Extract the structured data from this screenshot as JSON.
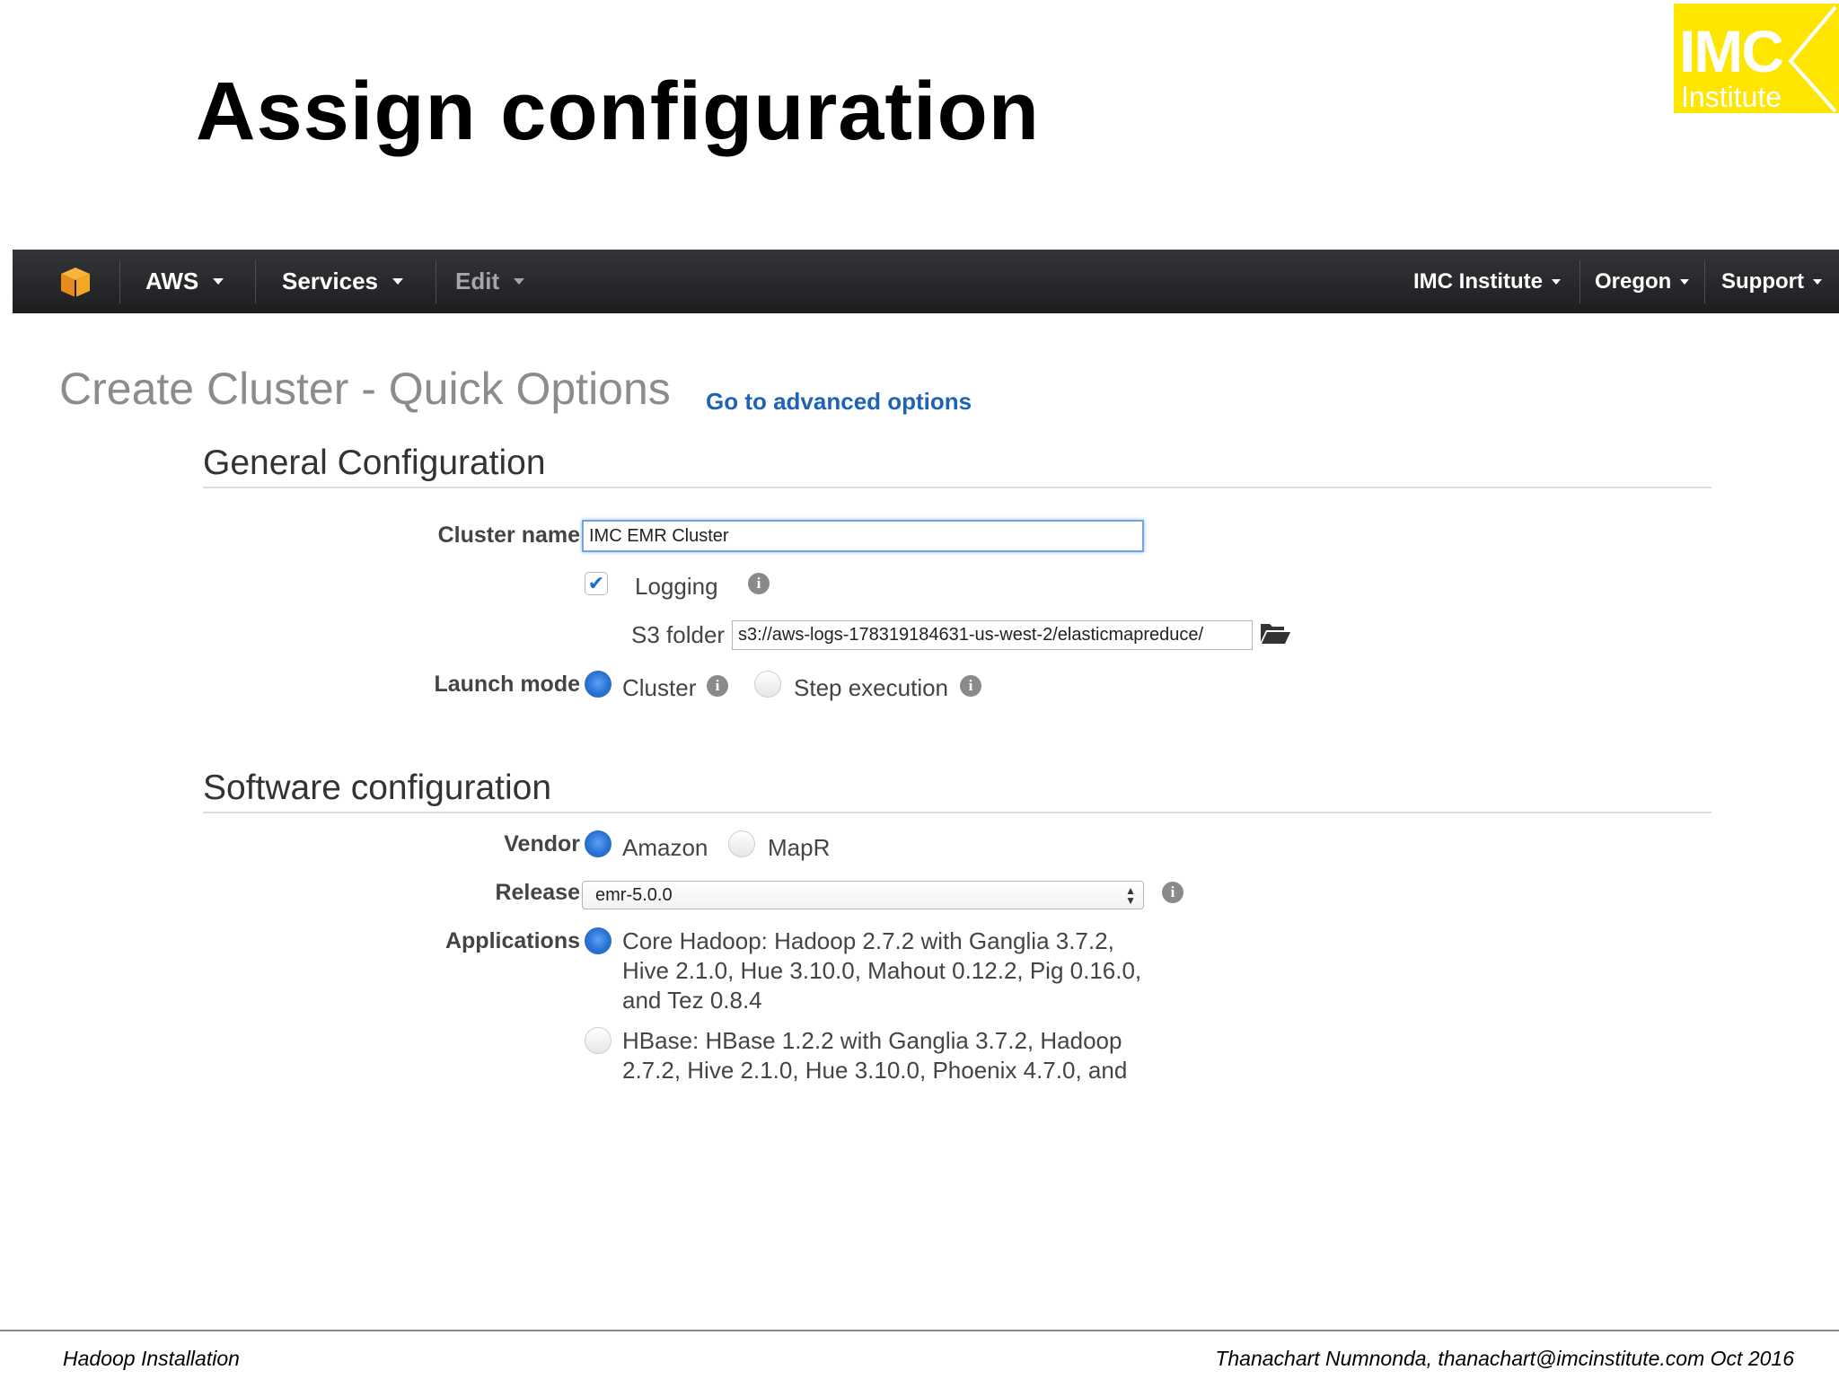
{
  "slide": {
    "title": "Assign configuration",
    "logo": {
      "line1": "IMC",
      "line2": "Institute"
    },
    "footer_left": "Hadoop Installation",
    "footer_right": "Thanachart Numnonda,  thanachart@imcinstitute.com  Oct 2016"
  },
  "navbar": {
    "cube_icon": "aws-cube-icon",
    "aws": "AWS",
    "services": "Services",
    "edit": "Edit",
    "account": "IMC Institute",
    "region": "Oregon",
    "support": "Support"
  },
  "page": {
    "heading": "Create Cluster - Quick Options",
    "advanced_link": "Go to advanced options"
  },
  "general": {
    "title": "General Configuration",
    "cluster_name_label": "Cluster name",
    "cluster_name_value": "IMC EMR Cluster",
    "logging_label": "Logging",
    "logging_checked": true,
    "s3_folder_label": "S3 folder",
    "s3_folder_value": "s3://aws-logs-178319184631-us-west-2/elasticmapreduce/",
    "launch_mode_label": "Launch mode",
    "launch_mode_options": [
      "Cluster",
      "Step execution"
    ],
    "launch_mode_selected": "Cluster"
  },
  "software": {
    "title": "Software configuration",
    "vendor_label": "Vendor",
    "vendor_options": [
      "Amazon",
      "MapR"
    ],
    "vendor_selected": "Amazon",
    "release_label": "Release",
    "release_value": "emr-5.0.0",
    "applications_label": "Applications",
    "applications": [
      {
        "line1": "Core Hadoop: Hadoop 2.7.2 with Ganglia 3.7.2,",
        "line2": "Hive 2.1.0, Hue 3.10.0, Mahout 0.12.2, Pig 0.16.0,",
        "line3": "and Tez 0.8.4",
        "selected": true
      },
      {
        "line1": "HBase: HBase 1.2.2 with Ganglia 3.7.2, Hadoop",
        "line2": "2.7.2, Hive 2.1.0, Hue 3.10.0, Phoenix 4.7.0, and",
        "selected": false
      }
    ]
  },
  "colors": {
    "navbar": "#232527",
    "link": "#1f63b4",
    "radio_selected": "#2a74d8",
    "logo_yellow": "#ffe600"
  }
}
